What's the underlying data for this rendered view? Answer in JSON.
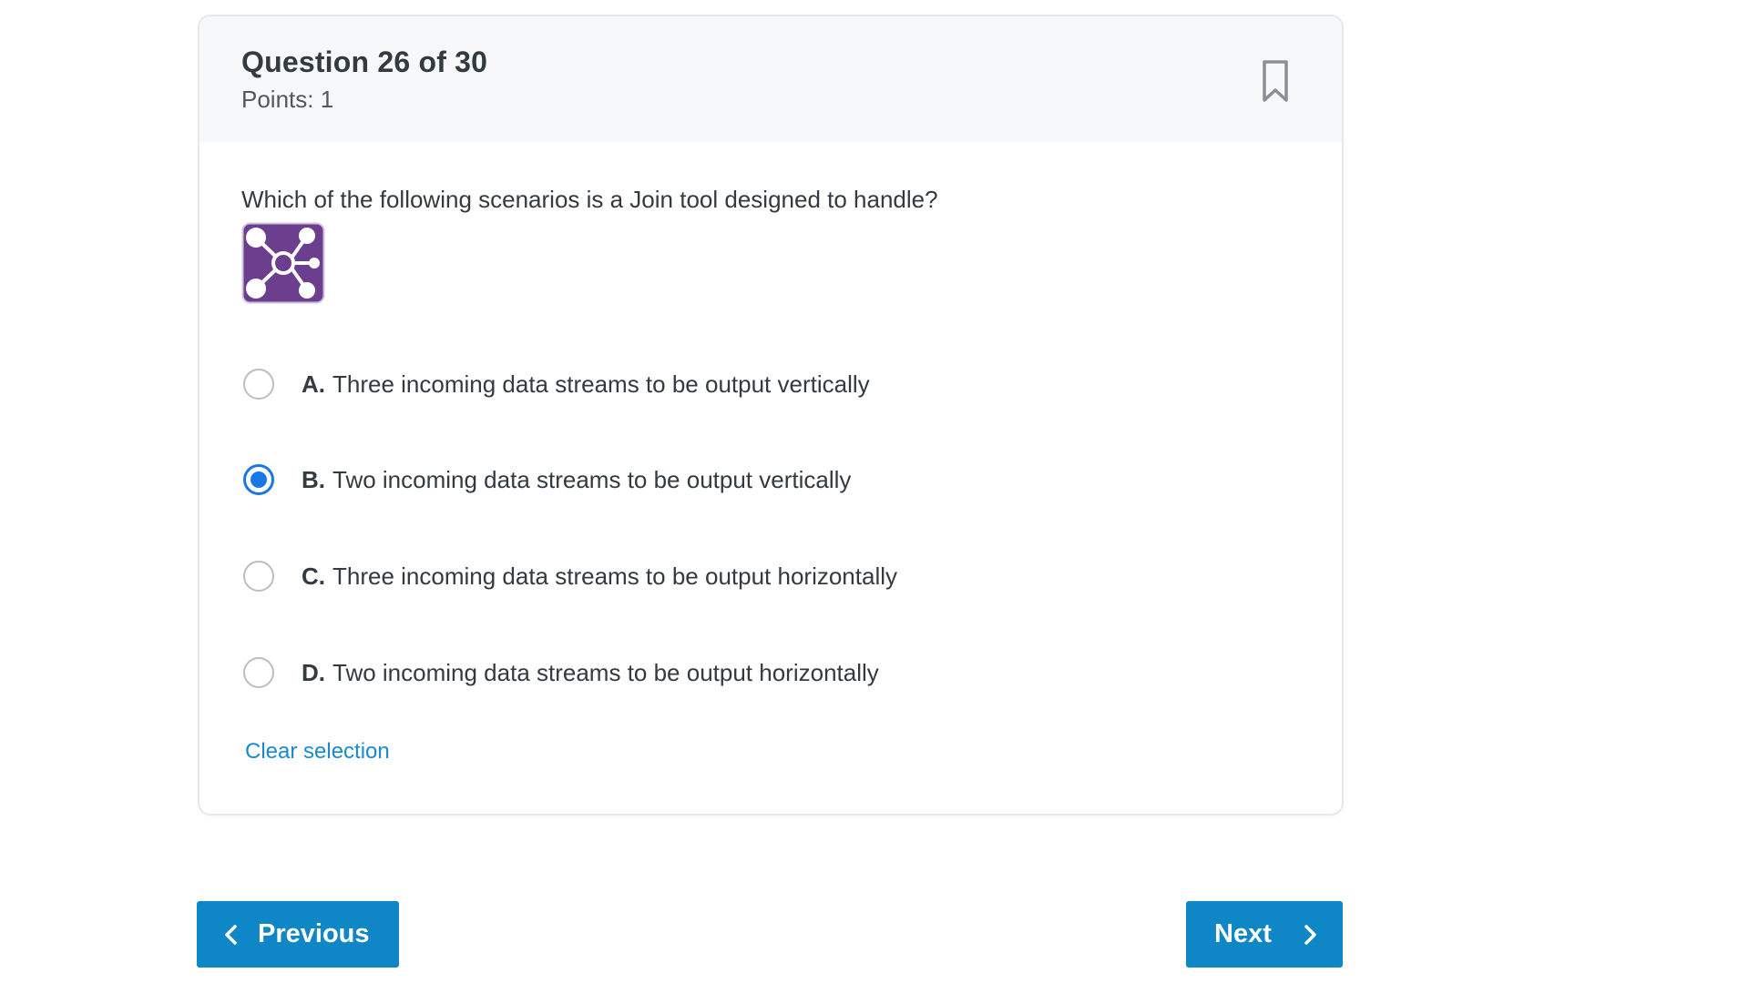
{
  "question": {
    "title": "Question 26 of 30",
    "points": "Points: 1",
    "prompt": "Which of the following scenarios is a Join tool designed to handle?",
    "image_icon": "join-tool-icon",
    "options": [
      {
        "letter": "A.",
        "text": "Three incoming data streams to be output vertically",
        "selected": false
      },
      {
        "letter": "B.",
        "text": "Two incoming data streams to be output vertically",
        "selected": true
      },
      {
        "letter": "C.",
        "text": "Three incoming data streams to be output horizontally",
        "selected": false
      },
      {
        "letter": "D.",
        "text": "Two incoming data streams to be output horizontally",
        "selected": false
      }
    ],
    "clear_label": "Clear selection"
  },
  "header": {
    "bookmark_icon": "bookmark-icon"
  },
  "navigation": {
    "previous_label": "Previous",
    "next_label": "Next"
  },
  "colors": {
    "accent": "#0f86c6",
    "selected_radio": "#1a78e6",
    "link": "#1a8ad0",
    "tool_icon_bg": "#6b3f8e"
  }
}
